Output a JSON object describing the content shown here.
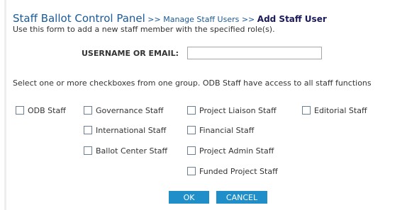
{
  "header": {
    "title": "Staff Ballot Control Panel",
    "separator1": ">>",
    "breadcrumb_manage": "Manage Staff Users",
    "separator2": ">>",
    "current_page": "Add Staff User"
  },
  "description": "Use this form to add a new staff member with the specified role(s).",
  "username": {
    "label": "USERNAME OR EMAIL:",
    "value": ""
  },
  "instruction": "Select one or more checkboxes from one group. ODB Staff have access to all staff functions",
  "checkboxes": [
    {
      "label": "ODB Staff",
      "checked": false
    },
    {
      "label": "Governance Staff",
      "checked": false
    },
    {
      "label": "International Staff",
      "checked": false
    },
    {
      "label": "Ballot Center Staff",
      "checked": false
    },
    {
      "label": "Project Liaison Staff",
      "checked": false
    },
    {
      "label": "Financial Staff",
      "checked": false
    },
    {
      "label": "Project Admin Staff",
      "checked": false
    },
    {
      "label": "Funded Project Staff",
      "checked": false
    },
    {
      "label": "Editorial Staff",
      "checked": false
    }
  ],
  "buttons": {
    "ok": "OK",
    "cancel": "CANCEL"
  },
  "colors": {
    "title": "#1a5a96",
    "button": "#1f8ec9"
  }
}
